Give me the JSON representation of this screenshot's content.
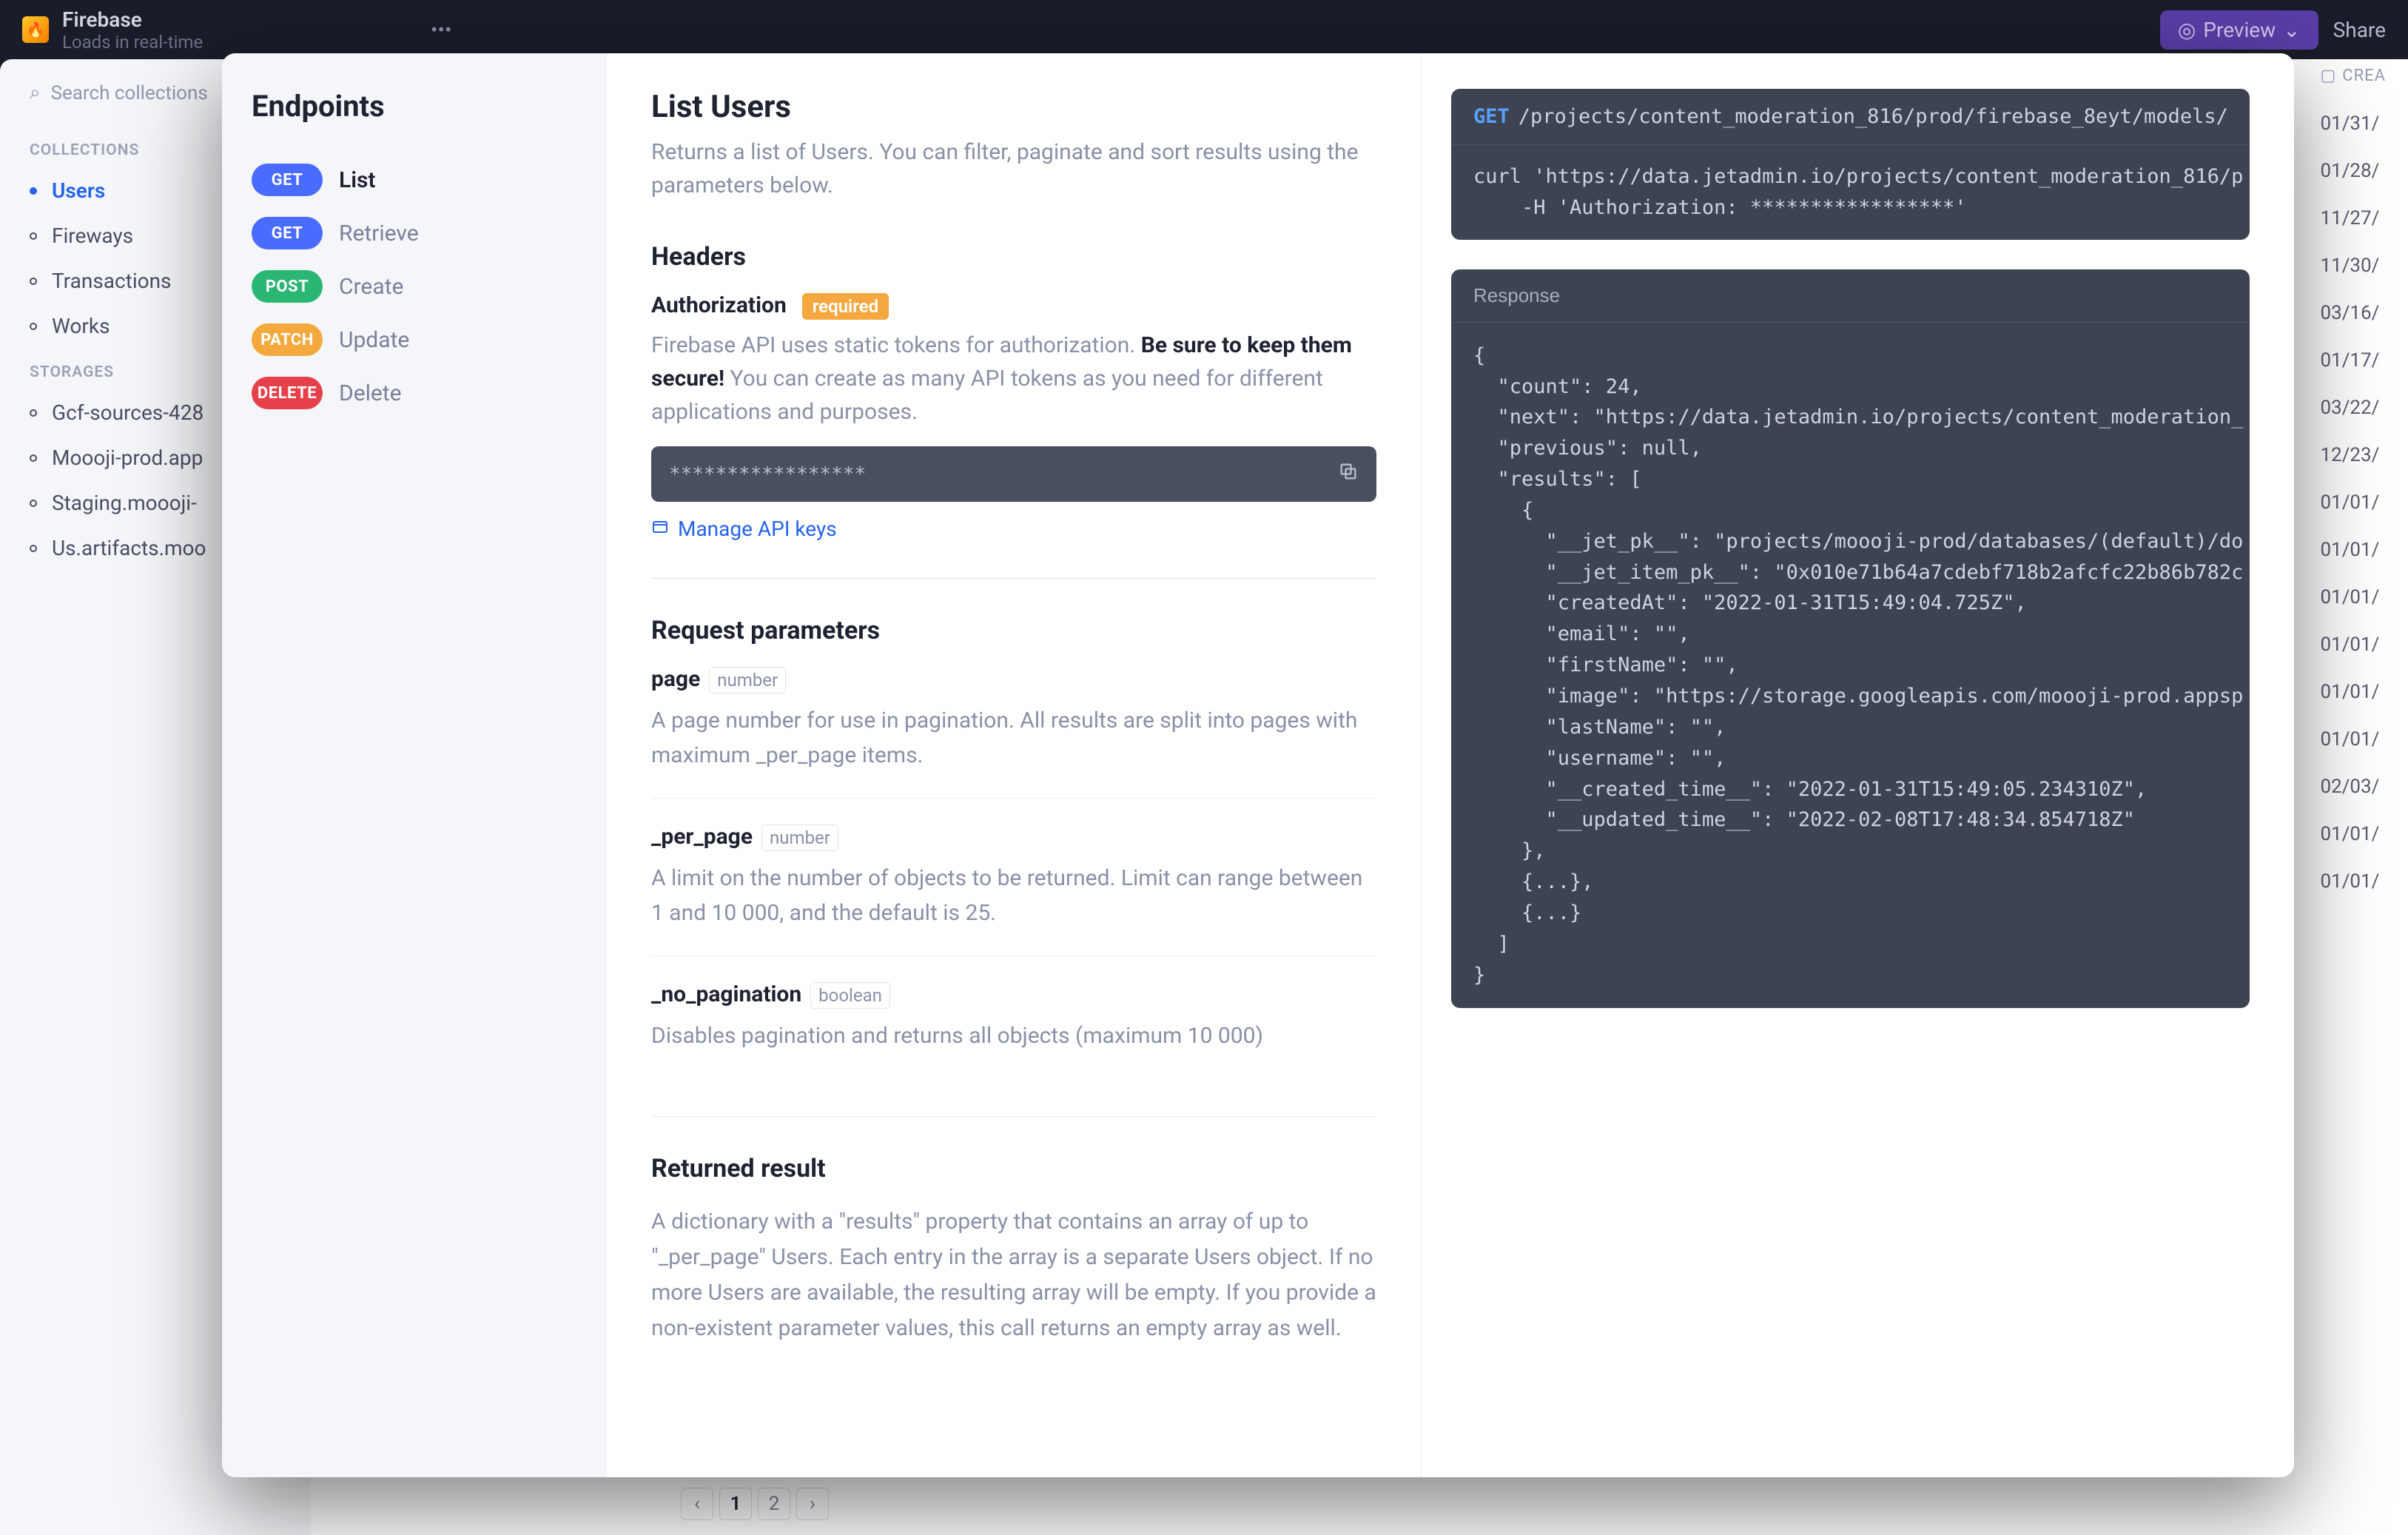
{
  "bg": {
    "app_title": "Firebase",
    "app_subtitle": "Loads in real-time",
    "more_btn": "•••",
    "preview_label": "Preview",
    "share_label": "Share",
    "search_placeholder": "Search collections",
    "collections_label": "COLLECTIONS",
    "storages_label": "STORAGES",
    "collections": [
      "Users",
      "Fireways",
      "Transactions",
      "Works"
    ],
    "storages": [
      "Gcf-sources-428",
      "Moooji-prod.app",
      "Staging.moooji-",
      "Us.artifacts.moo"
    ],
    "dates_header": "CREA",
    "dates": [
      "01/31/",
      "01/28/",
      "11/27/",
      "11/30/",
      "03/16/",
      "01/17/",
      "03/22/",
      "12/23/",
      "01/01/",
      "01/01/",
      "01/01/",
      "01/01/",
      "01/01/",
      "01/01/",
      "02/03/",
      "01/01/",
      "01/01/"
    ],
    "pager": {
      "prev": "‹",
      "p1": "1",
      "p2": "2",
      "next": "›"
    }
  },
  "endpoints_title": "Endpoints",
  "endpoints": [
    {
      "method": "GET",
      "label": "List",
      "active": true
    },
    {
      "method": "GET",
      "label": "Retrieve"
    },
    {
      "method": "POST",
      "label": "Create"
    },
    {
      "method": "PATCH",
      "label": "Update"
    },
    {
      "method": "DELETE",
      "label": "Delete"
    }
  ],
  "doc": {
    "title": "List Users",
    "subtitle": "Returns a list of Users. You can filter, paginate and sort results using the parameters below.",
    "headers_h": "Headers",
    "auth_label": "Authorization",
    "required_label": "required",
    "auth_desc_pre": "Firebase API uses static tokens for authorization. ",
    "auth_desc_bold": "Be sure to keep them secure!",
    "auth_desc_post": " You can create as many API tokens as you need for different applications and purposes.",
    "token_mask": "*****************",
    "manage_link": "Manage API keys",
    "req_params_h": "Request parameters",
    "params": [
      {
        "name": "page",
        "type": "number",
        "desc": "A page number for use in pagination. All results are split into pages with maximum _per_page items."
      },
      {
        "name": "_per_page",
        "type": "number",
        "desc": "A limit on the number of objects to be returned. Limit can range between 1 and 10 000, and the default is 25."
      },
      {
        "name": "_no_pagination",
        "type": "boolean",
        "desc": "Disables pagination and returns all objects (maximum 10 000)"
      }
    ],
    "returned_h": "Returned result",
    "returned_desc": "A dictionary with a \"results\" property that contains an array of up to \"_per_page\" Users. Each entry in the array is a separate Users object. If no more Users are available, the resulting array will be empty. If you provide a non-existent parameter values, this call returns an empty array as well."
  },
  "code": {
    "method": "GET",
    "url": "/projects/content_moderation_816/prod/firebase_8eyt/models/",
    "curl_line1": "curl 'https://data.jetadmin.io/projects/content_moderation_816/p",
    "curl_line2": "    -H 'Authorization: *****************'",
    "response_label": "Response",
    "response_body": "{\n  \"count\": 24,\n  \"next\": \"https://data.jetadmin.io/projects/content_moderation_\n  \"previous\": null,\n  \"results\": [\n    {\n      \"__jet_pk__\": \"projects/moooji-prod/databases/(default)/do\n      \"__jet_item_pk__\": \"0x010e71b64a7cdebf718b2afcfc22b86b782c\n      \"createdAt\": \"2022-01-31T15:49:04.725Z\",\n      \"email\": \"\",\n      \"firstName\": \"\",\n      \"image\": \"https://storage.googleapis.com/moooji-prod.appsp\n      \"lastName\": \"\",\n      \"username\": \"\",\n      \"__created_time__\": \"2022-01-31T15:49:05.234310Z\",\n      \"__updated_time__\": \"2022-02-08T17:48:34.854718Z\"\n    },\n    {...},\n    {...}\n  ]\n}"
  }
}
